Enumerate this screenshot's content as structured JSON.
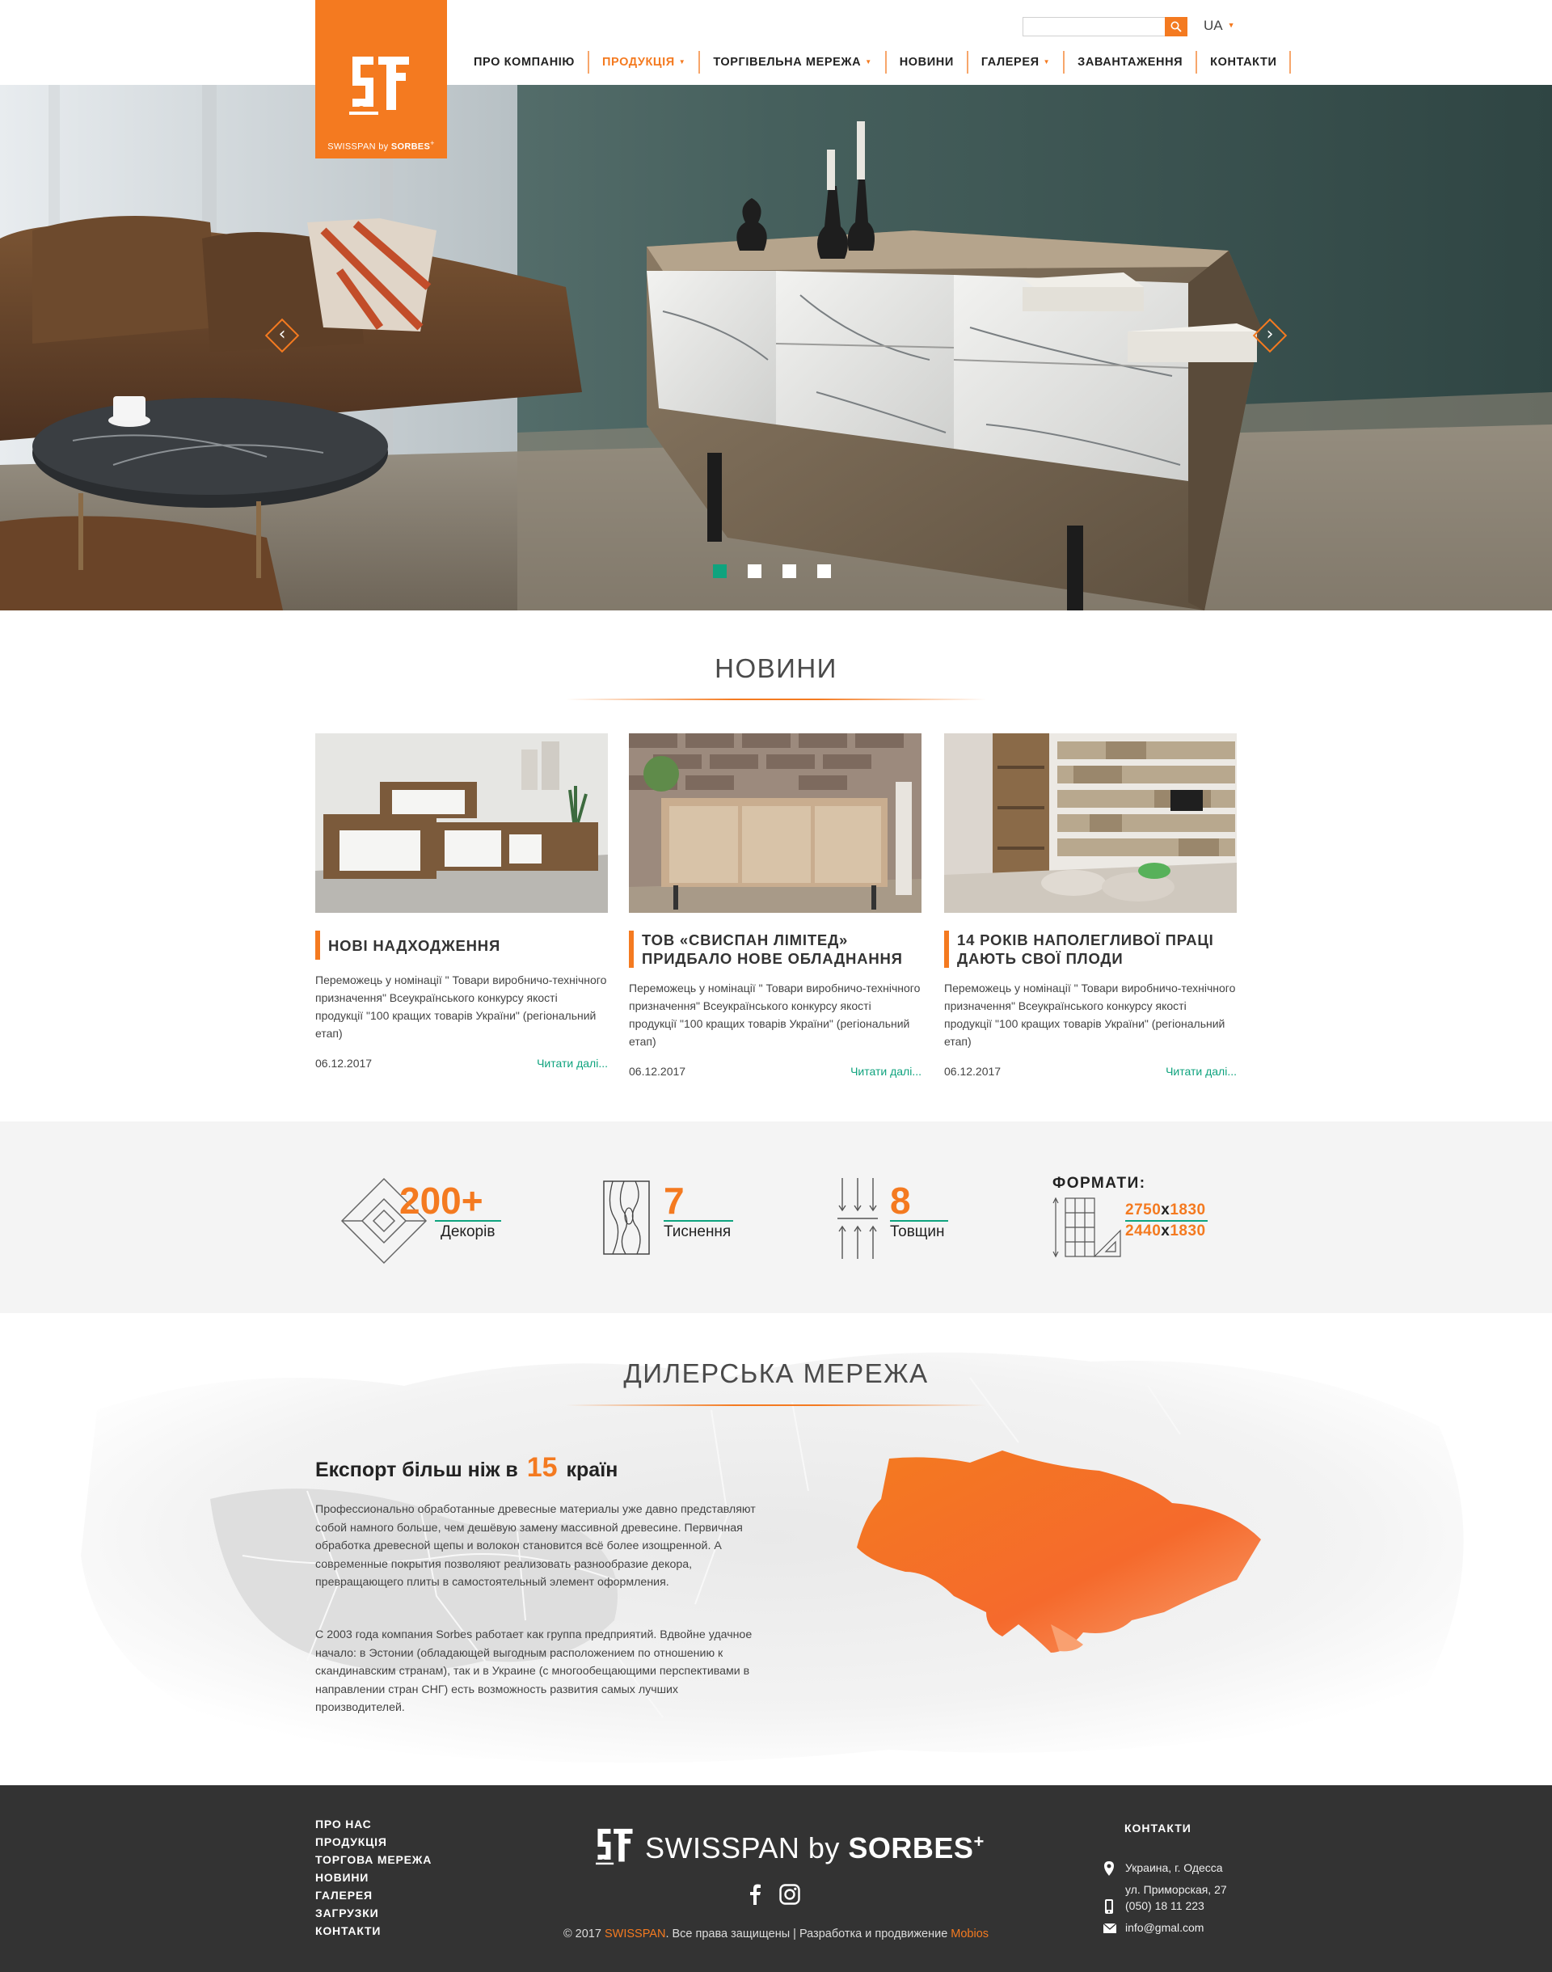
{
  "header": {
    "logo_caption_light": "SWISSPAN by",
    "logo_caption_bold": "SORBES",
    "logo_caption_sup": "+",
    "search": {
      "value": "",
      "placeholder": ""
    },
    "language": "UA",
    "nav": [
      {
        "label": "ПРО КОМПАНІЮ",
        "dropdown": false,
        "active": false
      },
      {
        "label": "ПРОДУКЦІЯ",
        "dropdown": true,
        "active": true
      },
      {
        "label": "ТОРГІВЕЛЬНА МЕРЕЖА",
        "dropdown": true,
        "active": false
      },
      {
        "label": "НОВИНИ",
        "dropdown": false,
        "active": false
      },
      {
        "label": "ГАЛЕРЕЯ",
        "dropdown": true,
        "active": false
      },
      {
        "label": "ЗАВАНТАЖЕННЯ",
        "dropdown": false,
        "active": false
      },
      {
        "label": "КОНТАКТИ",
        "dropdown": false,
        "active": false
      }
    ]
  },
  "hero": {
    "prev_icon": "chevron-left-icon",
    "next_icon": "chevron-right-icon",
    "slides_count": 4,
    "active_slide": 1
  },
  "news": {
    "title": "НОВИНИ",
    "items": [
      {
        "title": "НОВІ НАДХОДЖЕННЯ",
        "text": "Переможець у номінації \" Товари виробничо-технічного призначення\" Всеукраїнського конкурсу якості продукції \"100 кращих товарів України\" (регіональний етап)",
        "date": "06.12.2017",
        "more": "Читати далі..."
      },
      {
        "title": "ТОВ «СВИСПАН ЛІМІТЕД» ПРИДБАЛО НОВЕ ОБЛАДНАННЯ",
        "text": "Переможець у номінації \" Товари виробничо-технічного призначення\" Всеукраїнського конкурсу якості продукції \"100 кращих товарів України\" (регіональний етап)",
        "date": "06.12.2017",
        "more": "Читати далі..."
      },
      {
        "title": "14 РОКІВ НАПОЛЕГЛИВОЇ ПРАЦІ ДАЮТЬ СВОЇ ПЛОДИ",
        "text": "Переможець у номінації \" Товари виробничо-технічного призначення\" Всеукраїнського конкурсу якості продукції \"100 кращих товарів України\" (регіональний етап)",
        "date": "06.12.2017",
        "more": "Читати далі..."
      }
    ]
  },
  "stats": {
    "decors": {
      "value": "200+",
      "label": "Декорів",
      "icon": "diamond-decor-icon"
    },
    "textures": {
      "value": "7",
      "label": "Тиснення",
      "icon": "wood-grain-icon"
    },
    "thickness": {
      "value": "8",
      "label": "Товщин",
      "icon": "thickness-arrows-icon"
    },
    "formats": {
      "title": "ФОРМАТИ:",
      "icon": "sheet-format-icon",
      "rows": [
        {
          "a": "2750",
          "x": "х",
          "b": "1830"
        },
        {
          "a": "2440",
          "x": "х",
          "b": "1830"
        }
      ]
    }
  },
  "dealer": {
    "title": "ДИЛЕРСЬКА МЕРЕЖА",
    "export_prefix": "Експорт більш ніж в",
    "export_count": "15",
    "export_suffix": "країн",
    "paragraph1": "Профессионально обработанные древесные материалы уже давно представляют собой намного больше, чем дешёвую замену массивной древесине. Первичная обработка древесной щепы и волокон становится всё более изощренной. А современные покрытия позволяют реализовать разнообразие декора, превращающего плиты в самостоятельный элемент оформления.",
    "paragraph2": "С 2003 года компания Sorbes работает как группа предприятий. Вдвойне удачное начало: в Эстонии (обладающей выгодным расположением по отношению к скандинавским странам), так и в Украине (с многообещающими перспективами в направлении стран СНГ) есть возможность развития самых лучших производителей.",
    "highlight_color": "#f47a20"
  },
  "footer": {
    "menu": [
      "ПРО НАС",
      "ПРОДУКЦІЯ",
      "ТОРГОВА МЕРЕЖА",
      "НОВИНИ",
      "ГАЛЕРЕЯ",
      "ЗАГРУЗКИ",
      "КОНТАКТИ"
    ],
    "logo_light": "SWISSPAN by ",
    "logo_bold": "SORBES",
    "logo_sup": "+",
    "social": [
      "facebook-icon",
      "instagram-icon"
    ],
    "copyright_prefix": "© 2017 ",
    "copyright_brand": "SWISSPAN",
    "copyright_middle": ". Все права защищены | Разработка и продвижение ",
    "copyright_dev": "Mobios",
    "contacts_title": "КОНТАКТИ",
    "address_line1": "Украина, г. Одесса",
    "address_line2": "ул. Приморская, 27",
    "phone": "(050) 18 11 223",
    "email": "info@gmal.com"
  },
  "colors": {
    "accent": "#f47a20",
    "green": "#0fa37e",
    "footer_bg": "#333333",
    "stats_bg": "#f4f4f4"
  }
}
